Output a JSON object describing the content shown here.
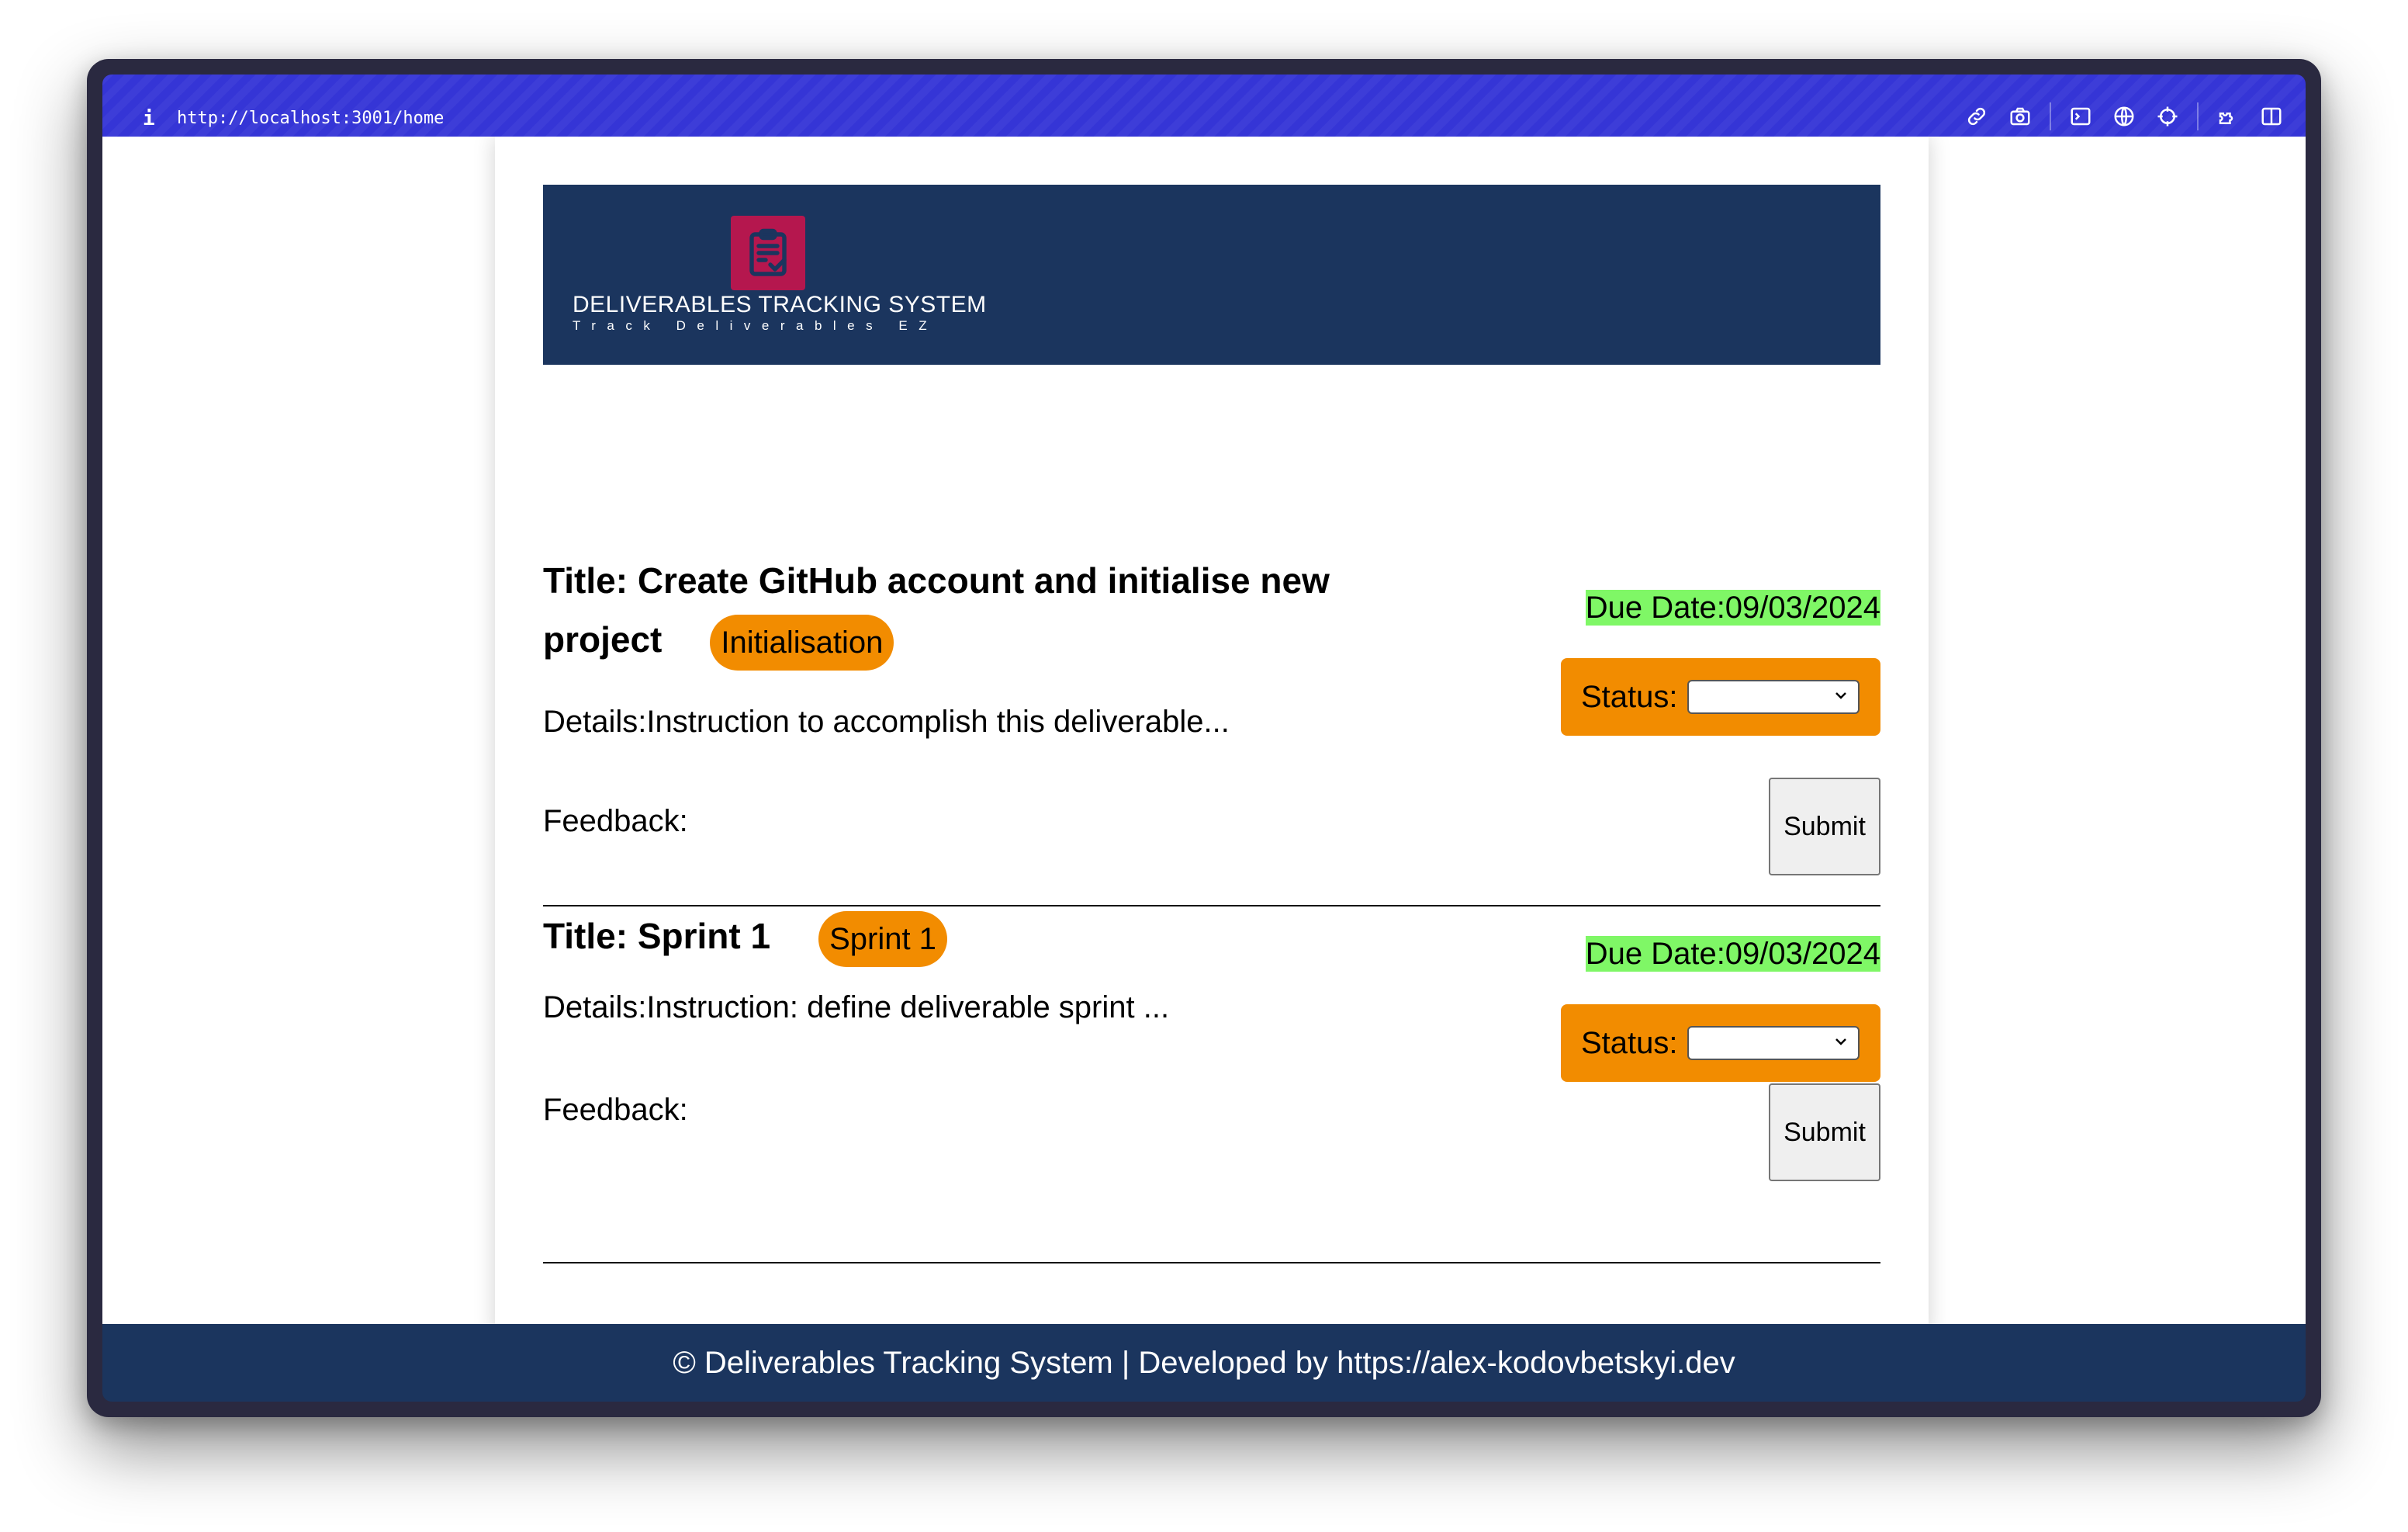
{
  "browser": {
    "info_icon": "i",
    "url": "http://localhost:3001/home",
    "toolbar_icons": [
      "link-icon",
      "camera-icon",
      "terminal-icon",
      "globe-icon",
      "crosshair-icon",
      "extension-icon",
      "sidebar-icon"
    ]
  },
  "header": {
    "logo_icon": "clipboard-check-icon",
    "title": "DELIVERABLES TRACKING SYSTEM",
    "subtitle": "Track Deliverables EZ"
  },
  "deliverables": [
    {
      "title": "Title: Create GitHub account and initialise new project",
      "tag": "Initialisation",
      "details": "Details:Instruction to accomplish this deliverable...",
      "feedback_label": "Feedback:",
      "due_date": "Due Date:09/03/2024",
      "status_label": "Status:",
      "status_value": "",
      "submit_label": "Submit"
    },
    {
      "title": "Title: Sprint 1",
      "tag": "Sprint 1",
      "details": "Details:Instruction: define deliverable sprint ...",
      "feedback_label": "Feedback:",
      "due_date": "Due Date:09/03/2024",
      "status_label": "Status:",
      "status_value": "",
      "submit_label": "Submit"
    }
  ],
  "footer": {
    "text": "© Deliverables Tracking System | Developed by https://alex-kodovbetskyi.dev"
  },
  "colors": {
    "chrome": "#3535d6",
    "navy": "#1b355e",
    "logo": "#b5174e",
    "tag_orange": "#f28c00",
    "due_green": "#7ff766"
  }
}
